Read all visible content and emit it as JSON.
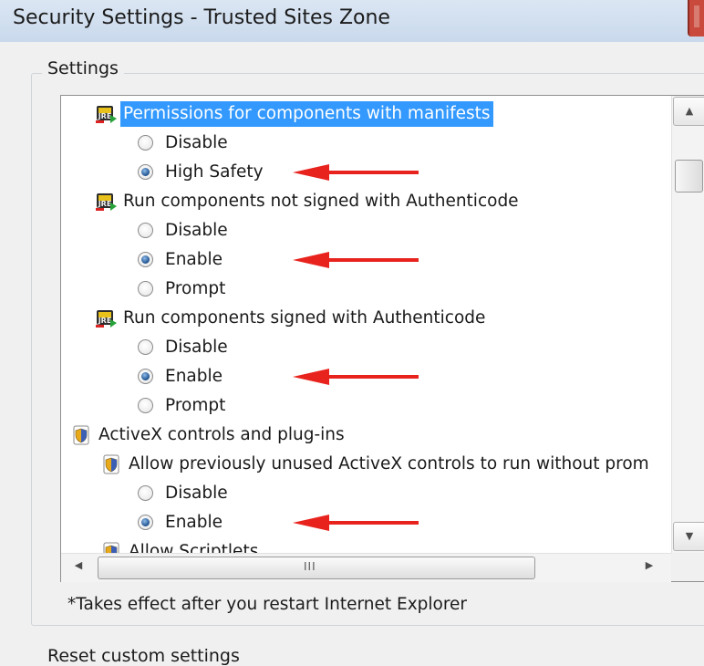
{
  "window": {
    "title": "Security Settings - Trusted Sites Zone"
  },
  "settings_group": {
    "label": "Settings"
  },
  "list": [
    {
      "type": "category",
      "icon": "jre-java-icon",
      "label": "Permissions for components with manifests",
      "selected": true
    },
    {
      "type": "option",
      "label": "Disable",
      "checked": false
    },
    {
      "type": "option",
      "label": "High Safety",
      "checked": true,
      "annotated": true
    },
    {
      "type": "category",
      "icon": "jre-java-icon",
      "label": "Run components not signed with Authenticode",
      "selected": false
    },
    {
      "type": "option",
      "label": "Disable",
      "checked": false
    },
    {
      "type": "option",
      "label": "Enable",
      "checked": true,
      "annotated": true
    },
    {
      "type": "option",
      "label": "Prompt",
      "checked": false
    },
    {
      "type": "category",
      "icon": "jre-java-icon",
      "label": "Run components signed with Authenticode",
      "selected": false
    },
    {
      "type": "option",
      "label": "Disable",
      "checked": false
    },
    {
      "type": "option",
      "label": "Enable",
      "checked": true,
      "annotated": true
    },
    {
      "type": "option",
      "label": "Prompt",
      "checked": false
    },
    {
      "type": "category",
      "icon": "shield-icon",
      "label": "ActiveX controls and plug-ins",
      "selected": false
    },
    {
      "type": "subcategory",
      "icon": "shield-icon",
      "label": "Allow previously unused ActiveX controls to run without prom",
      "selected": false
    },
    {
      "type": "option",
      "label": "Disable",
      "checked": false
    },
    {
      "type": "option",
      "label": "Enable",
      "checked": true,
      "annotated": true
    },
    {
      "type": "subcategory",
      "icon": "shield-icon",
      "label": "Allow Scriptlets",
      "selected": false
    }
  ],
  "scroll": {
    "up_glyph": "▲",
    "down_glyph": "▼",
    "left_glyph": "◀",
    "right_glyph": "▶",
    "grip": "III"
  },
  "note": "*Takes effect after you restart Internet Explorer",
  "reset_group": {
    "label": "Reset custom settings"
  },
  "colors": {
    "selection": "#3399ff",
    "arrow": "#e8231e"
  }
}
